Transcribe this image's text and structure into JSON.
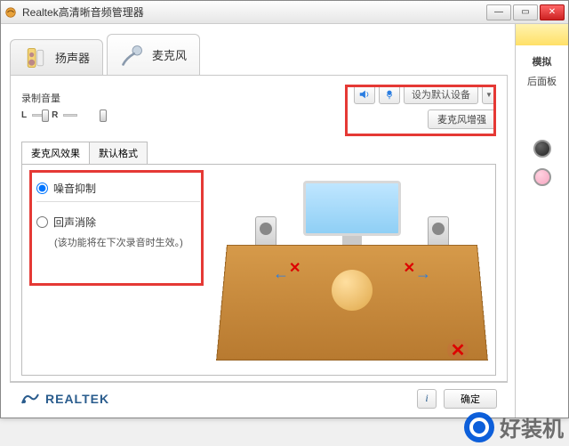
{
  "window": {
    "title": "Realtek高清晰音频管理器"
  },
  "tabs": {
    "speaker": "扬声器",
    "mic": "麦克风"
  },
  "recording": {
    "label": "录制音量",
    "l": "L",
    "r": "R"
  },
  "controls": {
    "set_default": "设为默认设备",
    "boost": "麦克风增强"
  },
  "subtabs": {
    "effects": "麦克风效果",
    "default_format": "默认格式"
  },
  "options": {
    "noise_suppression": "噪音抑制",
    "echo_cancel": "回声消除",
    "echo_note": "(该功能将在下次录音时生效。)"
  },
  "right": {
    "section": "模拟",
    "sub": "后面板"
  },
  "footer": {
    "brand": "REALTEK",
    "ok": "确定",
    "info": "i"
  },
  "watermark": {
    "text": "好装机"
  }
}
